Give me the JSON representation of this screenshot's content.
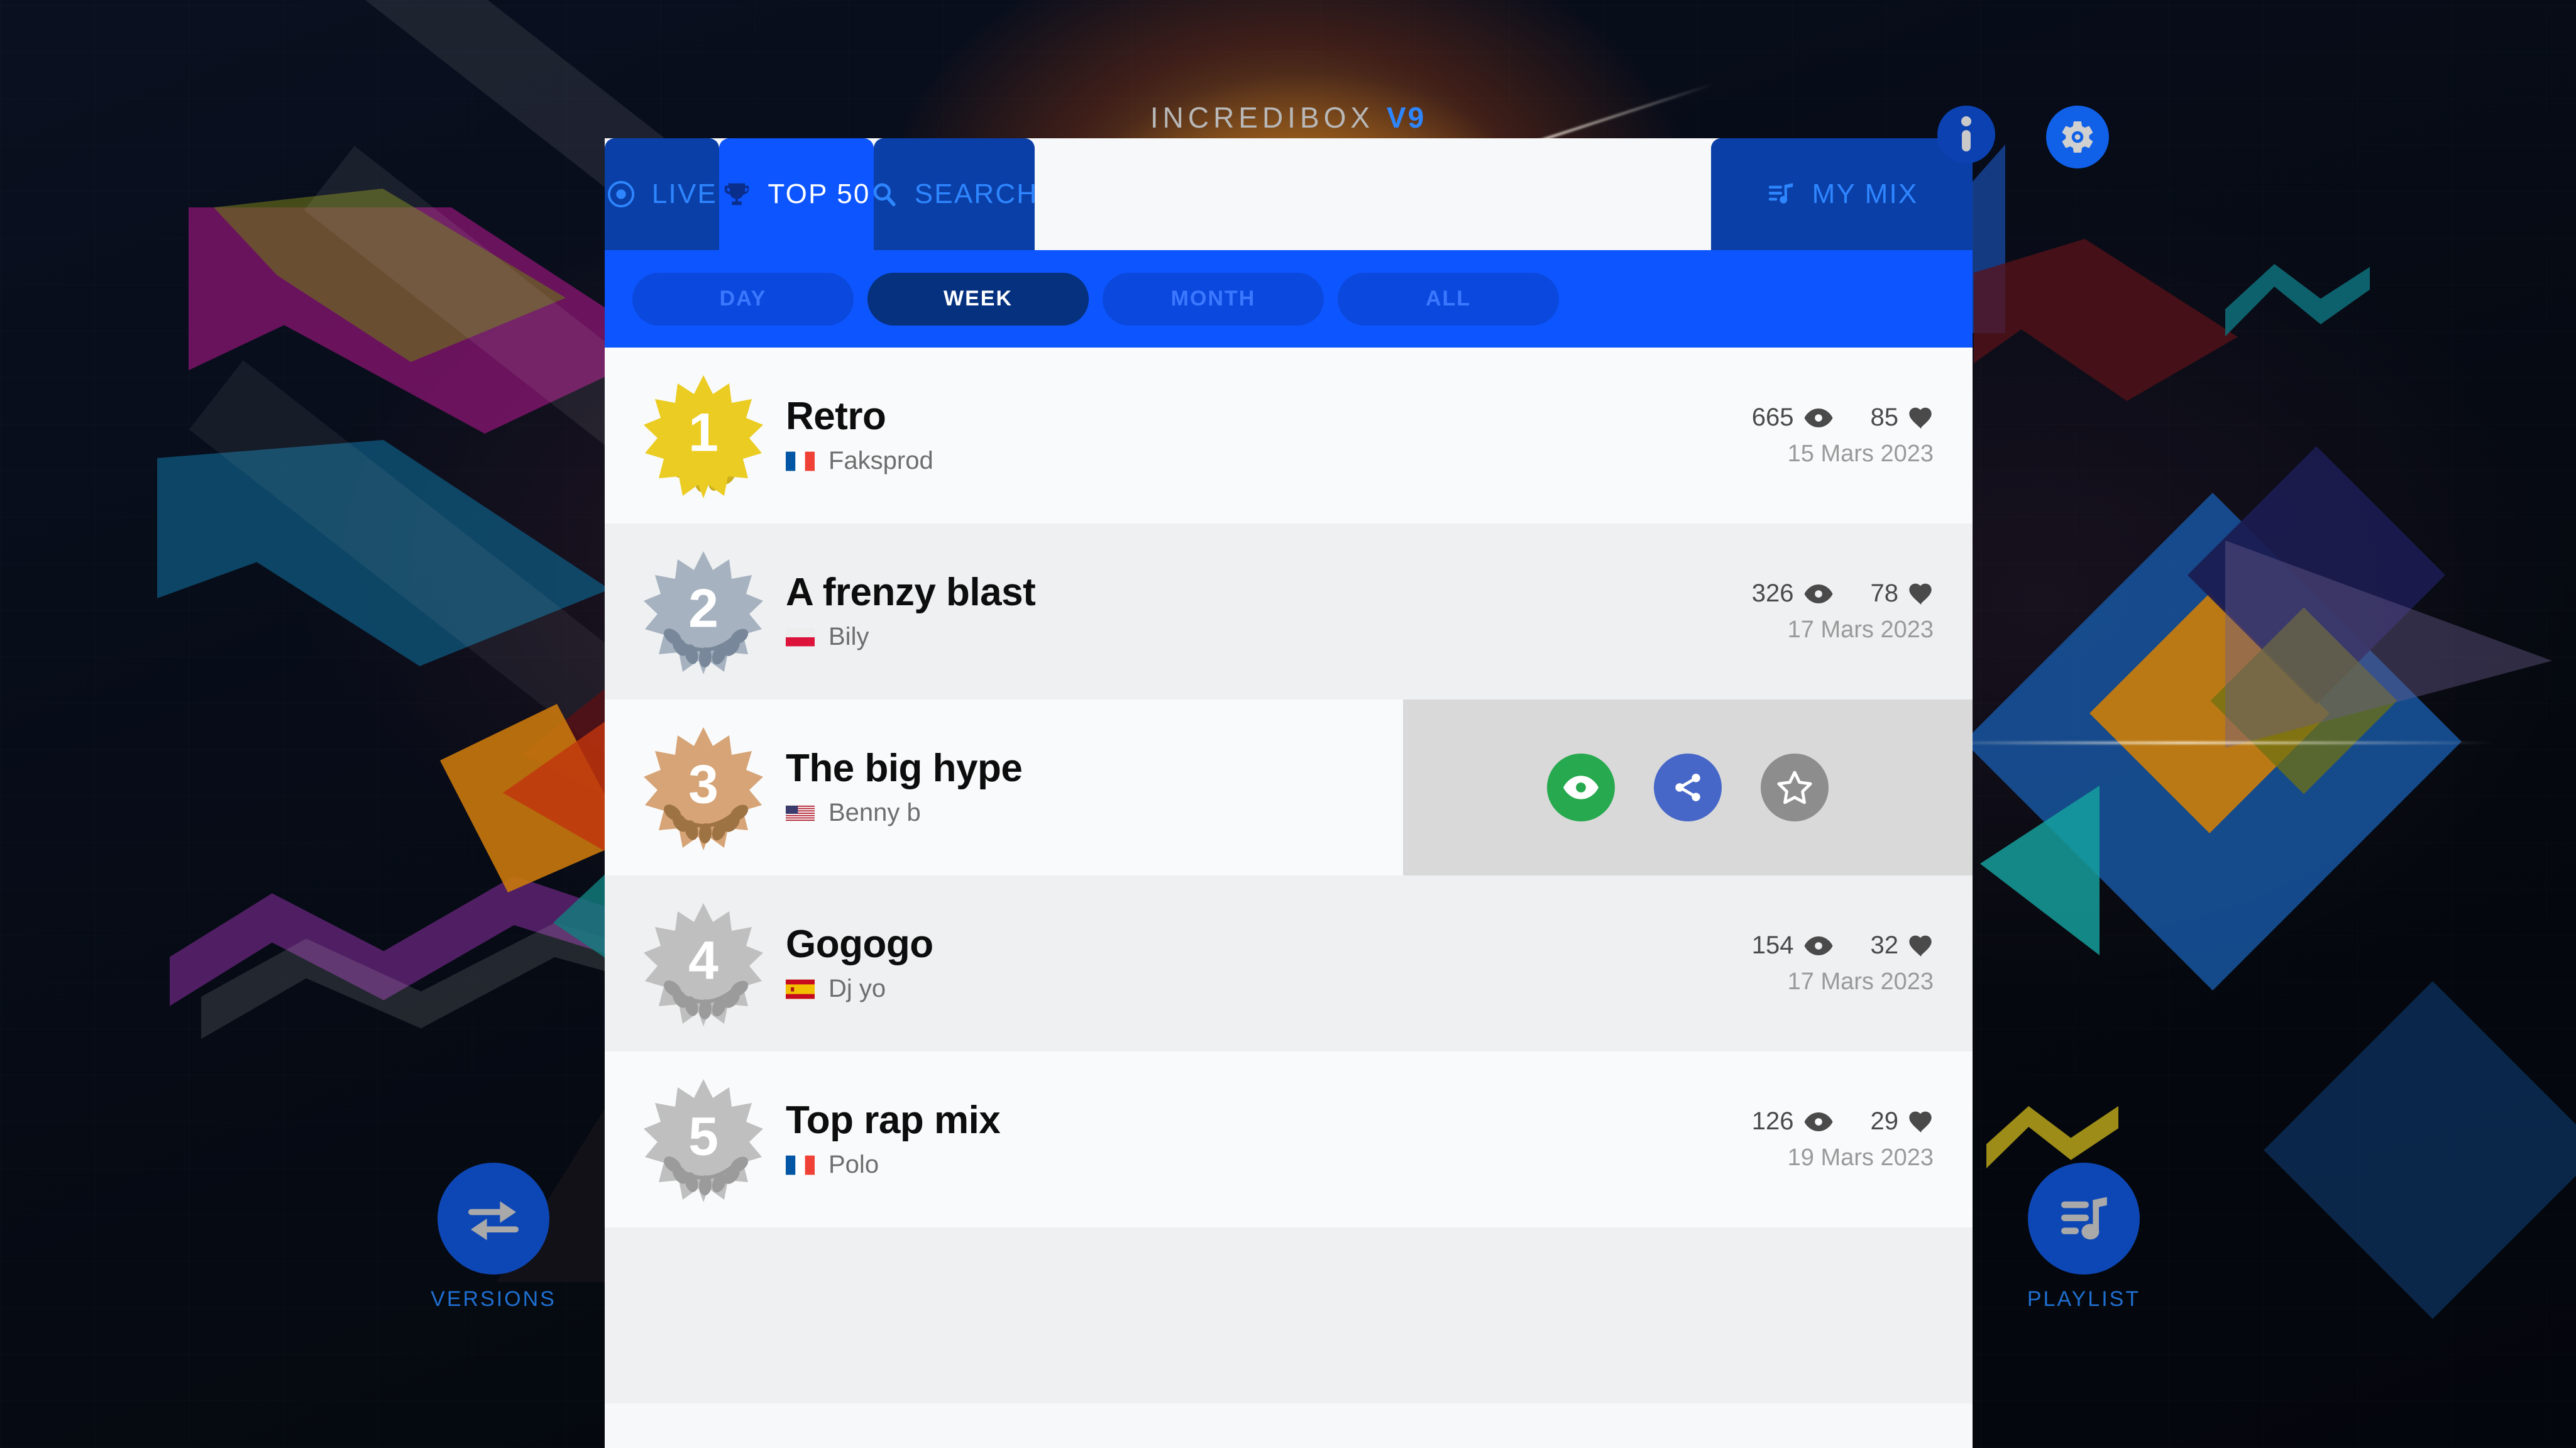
{
  "app": {
    "title_main": "INCREDIBOX",
    "title_version": "V9"
  },
  "top_icons": {
    "info_label": "info-icon",
    "settings_label": "gear-icon"
  },
  "tabs": [
    {
      "label": "LIVE",
      "icon": "live-icon",
      "active": false
    },
    {
      "label": "TOP 50",
      "icon": "trophy-icon",
      "active": true
    },
    {
      "label": "SEARCH",
      "icon": "search-icon",
      "active": false
    },
    {
      "label": "MY MIX",
      "icon": "playlist-icon",
      "active": false
    }
  ],
  "filters": [
    {
      "label": "DAY",
      "active": false
    },
    {
      "label": "WEEK",
      "active": true
    },
    {
      "label": "MONTH",
      "active": false
    },
    {
      "label": "ALL",
      "active": false
    }
  ],
  "rows": [
    {
      "rank": "1",
      "medal": "gold",
      "title": "Retro",
      "author": "Faksprod",
      "country": "France",
      "views": "665",
      "likes": "85",
      "date": "15 Mars 2023"
    },
    {
      "rank": "2",
      "medal": "silver",
      "title": "A frenzy blast",
      "author": "Bily",
      "country": "Poland",
      "views": "326",
      "likes": "78",
      "date": "17 Mars 2023"
    },
    {
      "rank": "3",
      "medal": "bronze",
      "title": "The big hype",
      "author": "Benny b",
      "country": "United States",
      "views": "",
      "likes": "",
      "date": "",
      "hovered": true
    },
    {
      "rank": "4",
      "medal": "plain",
      "title": "Gogogo",
      "author": "Dj yo",
      "country": "Spain",
      "views": "154",
      "likes": "32",
      "date": "17 Mars 2023"
    },
    {
      "rank": "5",
      "medal": "plain",
      "title": "Top rap mix",
      "author": "Polo",
      "country": "France",
      "views": "126",
      "likes": "29",
      "date": "19 Mars 2023"
    }
  ],
  "row_actions": {
    "play_label": "play-eye-button",
    "share_label": "share-button",
    "favorite_label": "favorite-star-button"
  },
  "corner_buttons": {
    "versions": {
      "label": "VERSIONS",
      "icon": "swap-arrows-icon"
    },
    "playlist": {
      "label": "PLAYLIST",
      "icon": "playlist-note-icon"
    }
  },
  "colors": {
    "accent_blue": "#0D55FF",
    "tab_inactive": "#0B3FA8",
    "pill_active": "#06317F",
    "gold": "#EBCC22",
    "silver": "#A6B2C0",
    "bronze": "#D6A476",
    "plain": "#BFBFBF",
    "action_green": "#27AA4F",
    "action_blue": "#4667C8",
    "action_gray": "#8D8D8D"
  }
}
